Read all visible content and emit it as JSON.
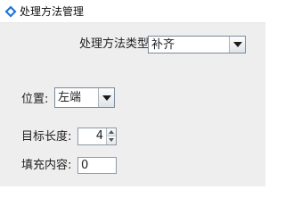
{
  "window": {
    "title": "处理方法管理",
    "icon": "app-diamond-icon"
  },
  "form": {
    "method_type": {
      "label": "处理方法类型:",
      "selected": "补齐",
      "arrow_icon": "triangle-down-icon"
    },
    "position": {
      "label": "位置:",
      "selected": "左端",
      "arrow_icon": "triangle-down-icon"
    },
    "target_length": {
      "label": "目标长度:",
      "value": "4",
      "up_icon": "spin-up-icon",
      "down_icon": "spin-down-icon"
    },
    "fill_content": {
      "label": "填充内容:",
      "value": "0"
    }
  },
  "colors": {
    "title_bar": "#ffffff",
    "panel": "#eeeeee",
    "field_border": "#7a8a99",
    "icon_blue": "#1e73d2"
  }
}
